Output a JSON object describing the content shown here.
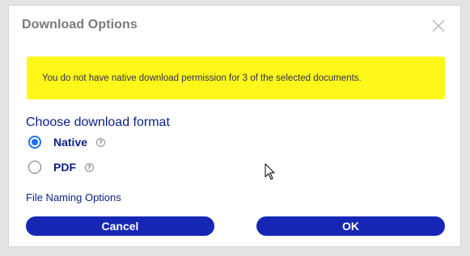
{
  "dialog": {
    "title": "Download Options",
    "close_icon": "close-icon"
  },
  "warning": {
    "message": "You do not have native download permission for 3 of the selected documents.",
    "background_color": "#fff719"
  },
  "format": {
    "heading": "Choose download format",
    "options": [
      {
        "label": "Native",
        "selected": true,
        "help_icon": "help-icon",
        "help_glyph": "?"
      },
      {
        "label": "PDF",
        "selected": false,
        "help_icon": "help-icon",
        "help_glyph": "?"
      }
    ]
  },
  "naming_link": "File Naming Options",
  "buttons": {
    "cancel_label": "Cancel",
    "ok_label": "OK",
    "color": "#1627b5"
  },
  "colors": {
    "accent_text": "#0a1f8a",
    "radio_selected": "#1a73e8"
  }
}
